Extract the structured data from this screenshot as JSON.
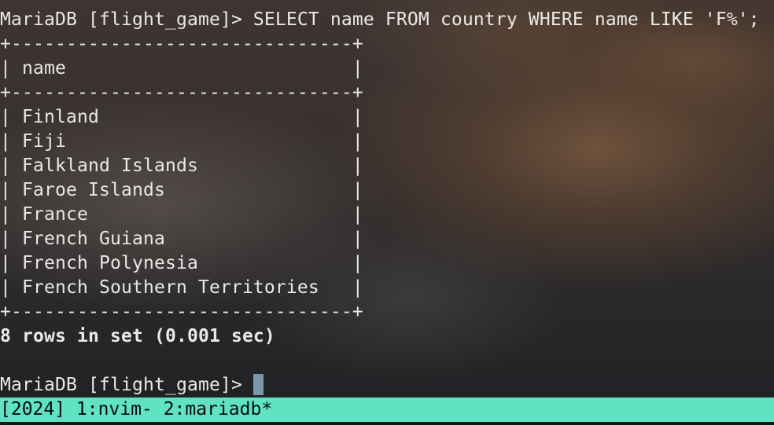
{
  "terminal": {
    "query_line": "MariaDB [flight_game]> SELECT name FROM country WHERE name LIKE 'F%';",
    "border_top": "+-------------------------------+",
    "header_row": "| name                          |",
    "border_header": "+-------------------------------+",
    "rows": [
      "| Finland                       |",
      "| Fiji                          |",
      "| Falkland Islands              |",
      "| Faroe Islands                 |",
      "| France                        |",
      "| French Guiana                 |",
      "| French Polynesia              |",
      "| French Southern Territories   |"
    ],
    "border_bottom": "+-------------------------------+",
    "result_summary": "8 rows in set (0.001 sec)",
    "prompt": "MariaDB [flight_game]> "
  },
  "status_bar": {
    "text": "[2024] 1:nvim- 2:mariadb*",
    "color": "#5fe3c3"
  }
}
